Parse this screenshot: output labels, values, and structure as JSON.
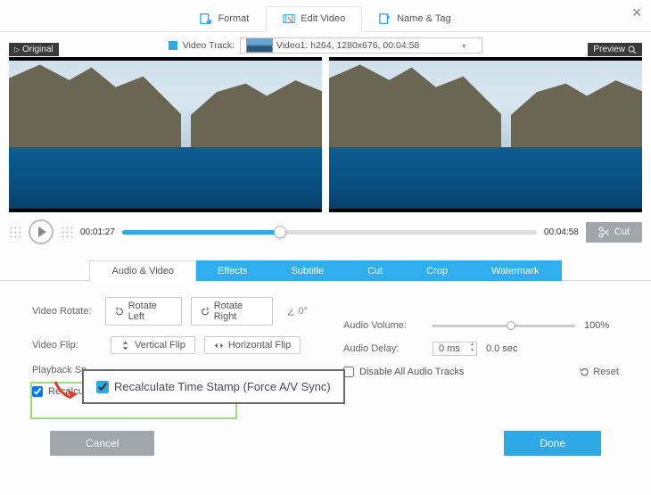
{
  "window": {
    "close_icon": "✕"
  },
  "top_tabs": {
    "format": "Format",
    "edit_video": "Edit Video",
    "name_tag": "Name & Tag"
  },
  "track": {
    "label": "Video Track:",
    "info": "Video1: h264, 1280x676, 00:04:58"
  },
  "badges": {
    "original": "Original",
    "preview": "Preview"
  },
  "timeline": {
    "current": "00:01:27",
    "total": "00:04:58",
    "cut": "Cut"
  },
  "sub_tabs": {
    "audio_video": "Audio & Video",
    "effects": "Effects",
    "subtitle": "Subtitle",
    "cut": "Cut",
    "crop": "Crop",
    "watermark": "Watermark"
  },
  "rotate": {
    "label": "Video Rotate:",
    "left": "Rotate Left",
    "right": "Rotate Right",
    "angle": "0°"
  },
  "flip": {
    "label": "Video Flip:",
    "vertical": "Vertical Flip",
    "horizontal": "Horizontal Flip"
  },
  "playback": {
    "label_truncated": "Playback Sp"
  },
  "recalc": {
    "short": "Recalcu",
    "full": "Recalculate Time Stamp (Force A/V Sync)"
  },
  "audio": {
    "volume_label": "Audio Volume:",
    "volume_value": "100%",
    "delay_label": "Audio Delay:",
    "delay_value": "0 ms",
    "delay_sec": "0.0 sec",
    "disable": "Disable All Audio Tracks",
    "reset": "Reset"
  },
  "footer": {
    "cancel": "Cancel",
    "done": "Done"
  }
}
